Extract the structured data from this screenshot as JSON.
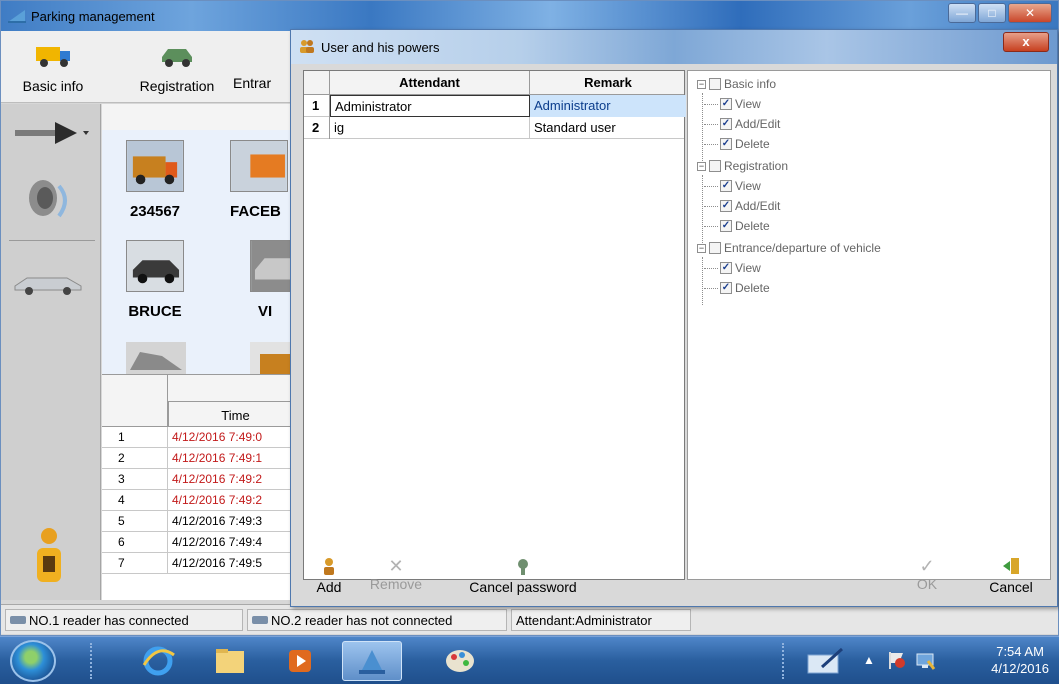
{
  "app": {
    "title": "Parking management",
    "title_bar_buttons": [
      "minimize",
      "maximize",
      "close"
    ]
  },
  "toolbar": {
    "items": [
      {
        "label": "Basic info",
        "icon": "truck-icon"
      },
      {
        "label": "Registration",
        "icon": "car-icon"
      },
      {
        "label": "Entrar",
        "icon": "entrance-icon"
      }
    ]
  },
  "left_rail": {
    "icons": [
      "arrow-dropdown-icon",
      "speaker-icon",
      "car-side-icon",
      "attendant-icon"
    ]
  },
  "vehicles": [
    {
      "plate": "234567",
      "icon": "truck-photo"
    },
    {
      "plate": "FACEB",
      "icon": "truck-photo"
    },
    {
      "plate": "BRUCE",
      "icon": "car-photo"
    },
    {
      "plate": "VI",
      "icon": "car-photo"
    }
  ],
  "time_table": {
    "header": "Time",
    "rows": [
      {
        "n": "1",
        "time": "4/12/2016 7:49:0",
        "color": "#c21a1a"
      },
      {
        "n": "2",
        "time": "4/12/2016 7:49:1",
        "color": "#c21a1a"
      },
      {
        "n": "3",
        "time": "4/12/2016 7:49:2",
        "color": "#c21a1a"
      },
      {
        "n": "4",
        "time": "4/12/2016 7:49:2",
        "color": "#c21a1a"
      },
      {
        "n": "5",
        "time": "4/12/2016 7:49:3",
        "color": "#000000"
      },
      {
        "n": "6",
        "time": "4/12/2016 7:49:4",
        "color": "#000000"
      },
      {
        "n": "7",
        "time": "4/12/2016 7:49:5",
        "color": "#000000"
      }
    ]
  },
  "status_bar": {
    "reader1": "NO.1 reader has connected",
    "reader2": "NO.2 reader has not connected",
    "attendant": "Attendant:Administrator"
  },
  "dialog": {
    "title": "User and his powers",
    "close_label": "x",
    "grid": {
      "col_attendant": "Attendant",
      "col_remark": "Remark",
      "rows": [
        {
          "n": "1",
          "attendant": "Administrator",
          "remark": "Administrator"
        },
        {
          "n": "2",
          "attendant": "ig",
          "remark": "Standard user"
        }
      ]
    },
    "permissions": [
      {
        "label": "Basic info",
        "checked": false,
        "children": [
          {
            "label": "View",
            "checked": true
          },
          {
            "label": "Add/Edit",
            "checked": true
          },
          {
            "label": "Delete",
            "checked": true
          }
        ]
      },
      {
        "label": "Registration",
        "checked": false,
        "children": [
          {
            "label": "View",
            "checked": true
          },
          {
            "label": "Add/Edit",
            "checked": true
          },
          {
            "label": "Delete",
            "checked": true
          }
        ]
      },
      {
        "label": "Entrance/departure of vehicle",
        "checked": false,
        "children": [
          {
            "label": "View",
            "checked": true
          },
          {
            "label": "Delete",
            "checked": true
          }
        ]
      }
    ],
    "buttons": {
      "add": "Add",
      "remove": "Remove",
      "cancel_password": "Cancel password",
      "ok": "OK",
      "cancel": "Cancel"
    }
  },
  "taskbar": {
    "apps": [
      "internet-explorer-icon",
      "folder-icon",
      "media-player-icon",
      "parking-app-icon",
      "paint-icon"
    ],
    "clock_time": "7:54 AM",
    "clock_date": "4/12/2016"
  }
}
